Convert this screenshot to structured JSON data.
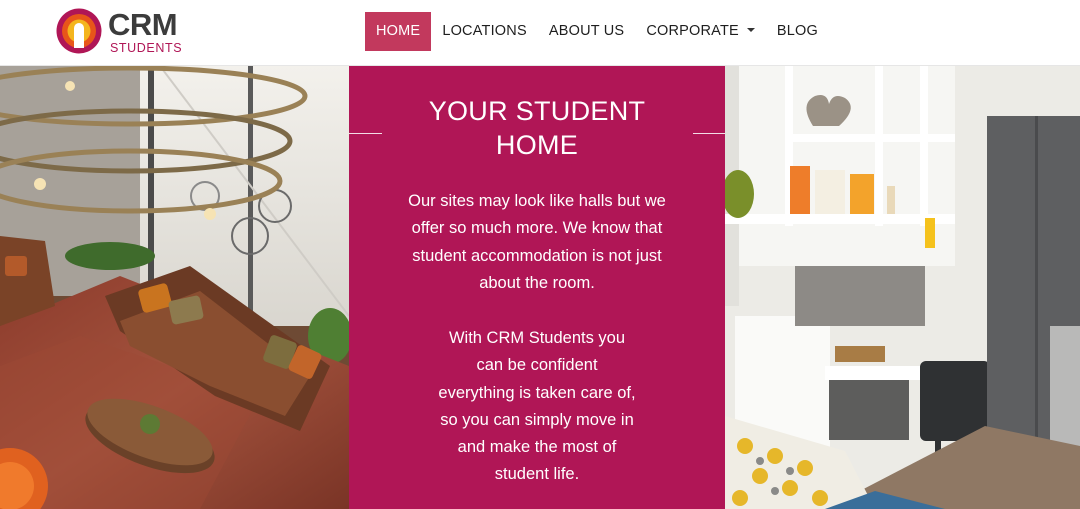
{
  "header": {
    "logo": {
      "wordmark": "CRM",
      "tagline": "STUDENTS"
    },
    "nav": [
      {
        "label": "HOME",
        "active": true
      },
      {
        "label": "LOCATIONS",
        "active": false
      },
      {
        "label": "ABOUT US",
        "active": false
      },
      {
        "label": "CORPORATE",
        "active": false,
        "dropdown": true
      },
      {
        "label": "BLOG",
        "active": false
      }
    ]
  },
  "hero": {
    "title_line1": "YOUR STUDENT",
    "title_line2": "HOME",
    "paragraph1": [
      "Our sites may look like halls but we",
      "offer so much more. We know that",
      "student accommodation is not just",
      "about the room."
    ],
    "paragraph2": [
      "With CRM Students you",
      "can be confident",
      "everything is taken care of,",
      "so you can simply move in",
      "and make the most of",
      "student life."
    ]
  },
  "colors": {
    "brand": "#b01656",
    "nav_active": "#c2395d",
    "logo_text": "#3c3c3c"
  }
}
